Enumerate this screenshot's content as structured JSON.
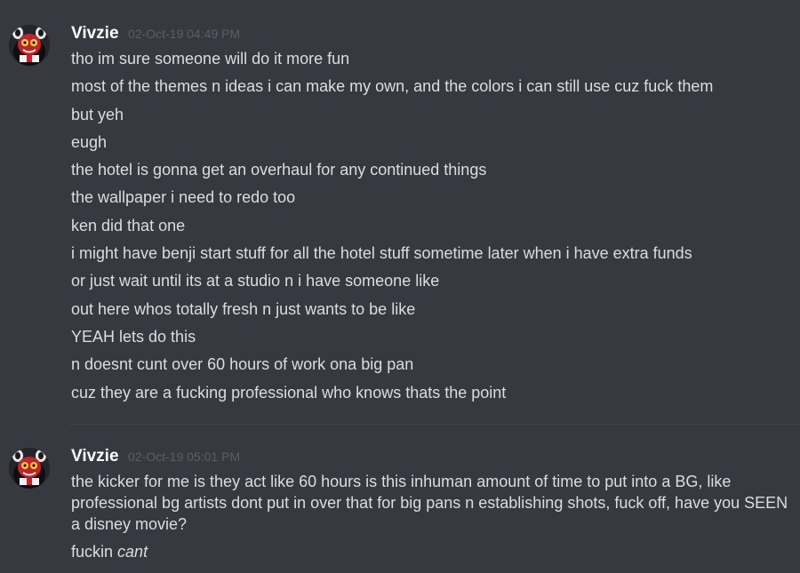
{
  "groups": [
    {
      "author": "Vivzie",
      "timestamp": "02-Oct-19 04:49 PM",
      "messages": [
        "tho im sure someone will do it more fun",
        "most of the themes n ideas i can make my own, and the colors i can still use cuz fuck them",
        "but yeh",
        "eugh",
        "the hotel is gonna get an overhaul for any continued things",
        "the wallpaper i need to redo too",
        "ken did that one",
        "i might have benji start stuff for all the hotel stuff sometime later when i have extra funds",
        "or just wait until its at a studio n i have someone like",
        "out here whos totally fresh n just wants to be like",
        "YEAH lets do this",
        "n doesnt cunt over 60 hours of work ona  big pan",
        "cuz they are a fucking professional who knows thats the point"
      ]
    },
    {
      "author": "Vivzie",
      "timestamp": "02-Oct-19 05:01 PM",
      "messages": [
        "the kicker for me is they act like 60 hours is this inhuman amount of time to put into a BG, like professional bg artists dont put in over that for big pans n establishing shots, fuck off, have you SEEN a disney movie?"
      ],
      "last_message": {
        "text": "fuckin",
        "emphasis": "cant"
      }
    }
  ],
  "colors": {
    "background": "#36393f",
    "author": "#ffffff",
    "timestamp": "#5c5f66",
    "message_text": "#dcddde",
    "divider": "#42454a"
  },
  "icons": {
    "avatar": "avatar-red-creature-icon"
  }
}
